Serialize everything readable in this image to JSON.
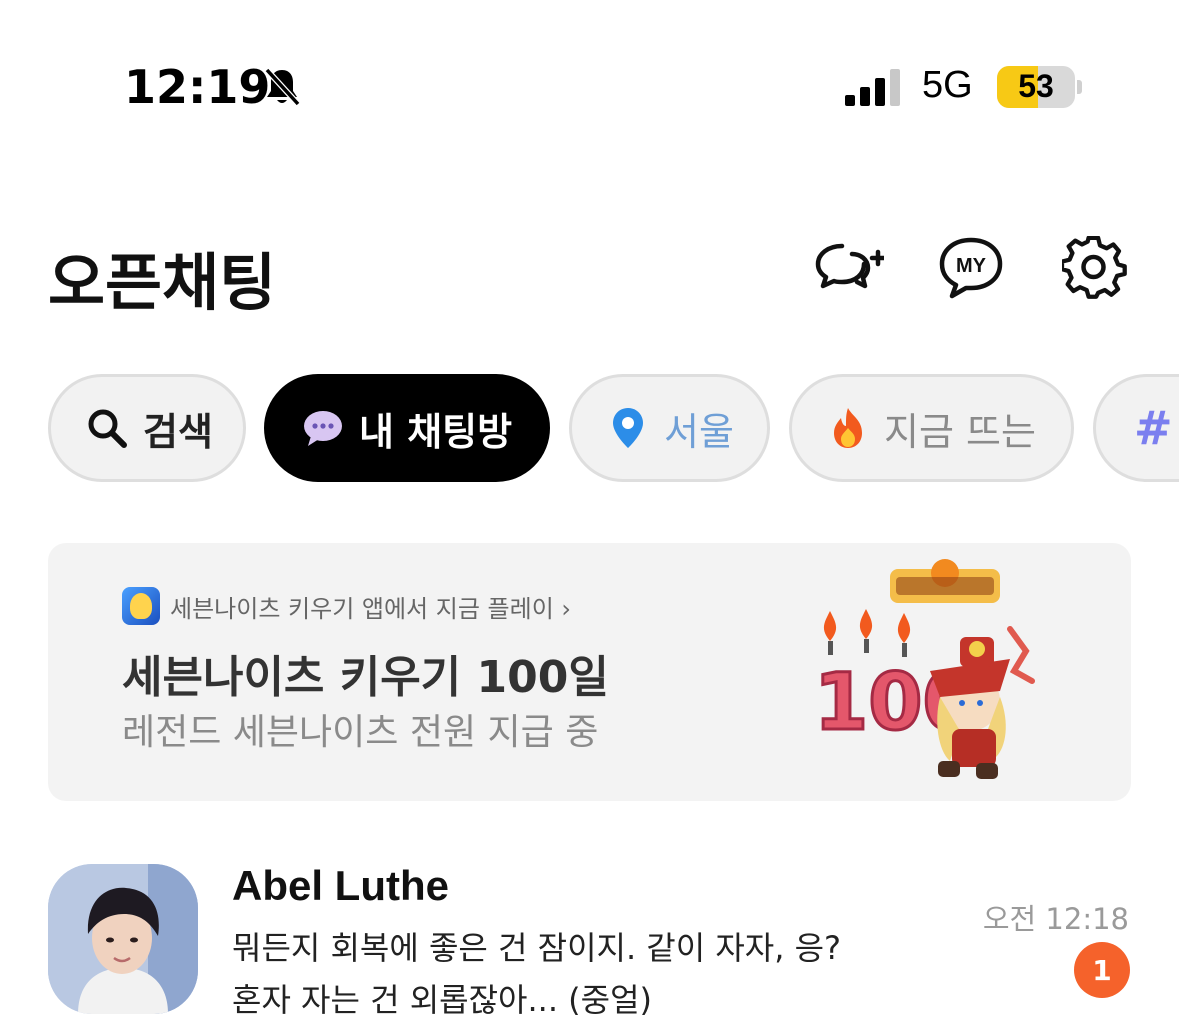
{
  "status_bar": {
    "time": "12:19",
    "network": "5G",
    "battery_percent": "53",
    "battery_level": 0.53,
    "battery_color": "#f7c915",
    "silent_icon": "bell-slash-icon",
    "signal_bars": 3
  },
  "header": {
    "title": "오픈채팅",
    "icons": [
      "new-chat-plus-icon",
      "my-chat-icon",
      "gear-icon"
    ],
    "my_icon_label": "MY"
  },
  "chips": [
    {
      "label": "검색",
      "icon": "search-icon",
      "active": false
    },
    {
      "label": "내 채팅방",
      "icon": "chat-bubble-icon",
      "active": true
    },
    {
      "label": "서울",
      "icon": "location-pin-icon",
      "active": false
    },
    {
      "label": "지금 뜨는",
      "icon": "fire-icon",
      "active": false
    },
    {
      "label": "#",
      "icon": "hashtag-icon",
      "active": false
    }
  ],
  "banner": {
    "top_text": "세븐나이츠 키우기 앱에서 지금 플레이 ›",
    "title": "세븐나이츠 키우기 100일",
    "subtitle": "레전드 세븐나이츠 전원 지급 중",
    "art_number": "100"
  },
  "chat_list": [
    {
      "name": "Abel Luthe",
      "message_line1": "뭐든지 회복에 좋은 건 잠이지. 같이 자자, 응?",
      "message_line2": "혼자 자는 건 외롭잖아... (중얼)",
      "time": "오전 12:18",
      "unread": "1"
    }
  ],
  "colors": {
    "accent_unread": "#f5622b",
    "chip_active_bg": "#000000",
    "chip_bg": "#f2f2f2"
  }
}
